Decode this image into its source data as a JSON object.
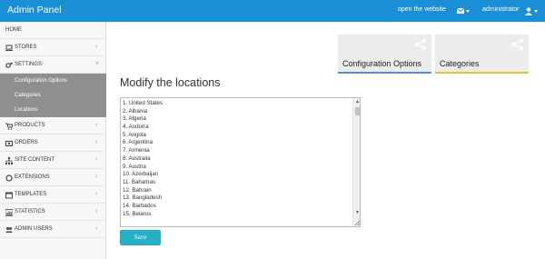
{
  "app": {
    "title": "Admin Panel"
  },
  "topbar": {
    "open_site_label": "open the website",
    "user_label": "administrator"
  },
  "sidebar": {
    "home_label": "HOME",
    "items": [
      {
        "label": "STORES",
        "icon": "laptop-icon"
      },
      {
        "label": "SETTINGS",
        "icon": "cogs-icon"
      },
      {
        "label": "PRODUCTS",
        "icon": "cart-icon"
      },
      {
        "label": "ORDERS",
        "icon": "money-icon"
      },
      {
        "label": "SITE CONTENT",
        "icon": "sitemap-icon"
      },
      {
        "label": "EXTENSIONS",
        "icon": "circle-icon"
      },
      {
        "label": "TEMPLATES",
        "icon": "window-icon"
      },
      {
        "label": "STATISTICS",
        "icon": "chart-icon"
      },
      {
        "label": "ADMIN USERS",
        "icon": "users-icon"
      }
    ],
    "settings_subitems": [
      "Configuration Options",
      "Categories",
      "Locations"
    ]
  },
  "tiles": [
    {
      "label": "Configuration Options",
      "accent": "#4a90d9"
    },
    {
      "label": "Categories",
      "accent": "#e8c23a"
    }
  ],
  "main": {
    "title": "Modify the locations",
    "locations": [
      "1. United States",
      "2. Albania",
      "3. Algeria",
      "4. Andorra",
      "5. Angola",
      "6. Argentina",
      "7. Armenia",
      "8. Australia",
      "9. Austria",
      "10. Azerbaijan",
      "11. Bahamas",
      "12. Bahrain",
      "13. Bangladesh",
      "14. Barbados",
      "15. Belarus"
    ],
    "save_label": "Save"
  },
  "colors": {
    "topbar": "#1a8fd6",
    "save_button": "#26b0c5",
    "sidebar_active": "#8f8f8f"
  }
}
